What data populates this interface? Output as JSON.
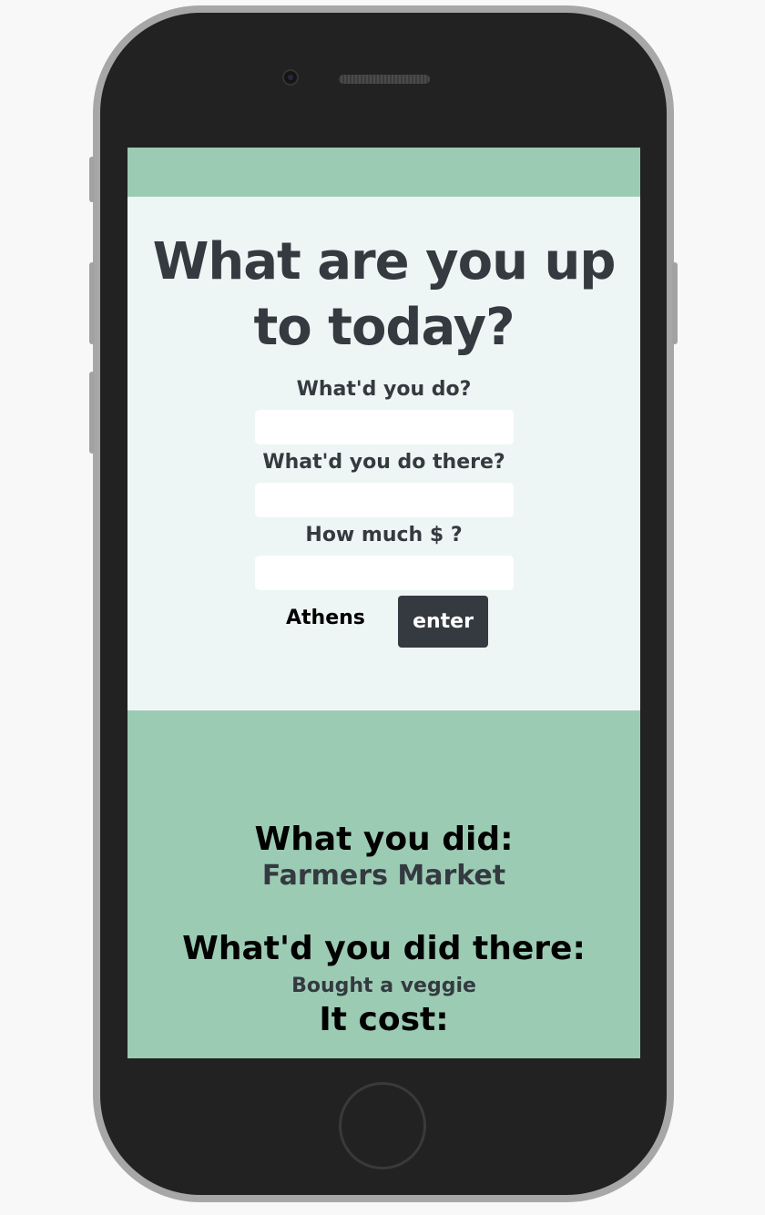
{
  "form": {
    "headline": "What are you up to today?",
    "label_what": "What'd you do?",
    "label_there": "What'd you do there?",
    "label_cost": "How much $ ?",
    "value_what": "",
    "value_there": "",
    "value_cost": "",
    "city": "Athens",
    "enter_label": "enter"
  },
  "results": {
    "did_heading": "What you did:",
    "did_value": "Farmers Market",
    "there_heading": "What'd you did there:",
    "there_value": "Bought a veggie",
    "cost_heading": "It cost:"
  },
  "colors": {
    "accent_green": "#9ccbb4",
    "form_bg": "#edf6f4",
    "dark_text": "#343a40",
    "button_bg": "#343a40"
  },
  "icons": {
    "camera": "camera-icon",
    "speaker": "speaker-grille-icon",
    "home": "home-button-icon"
  }
}
